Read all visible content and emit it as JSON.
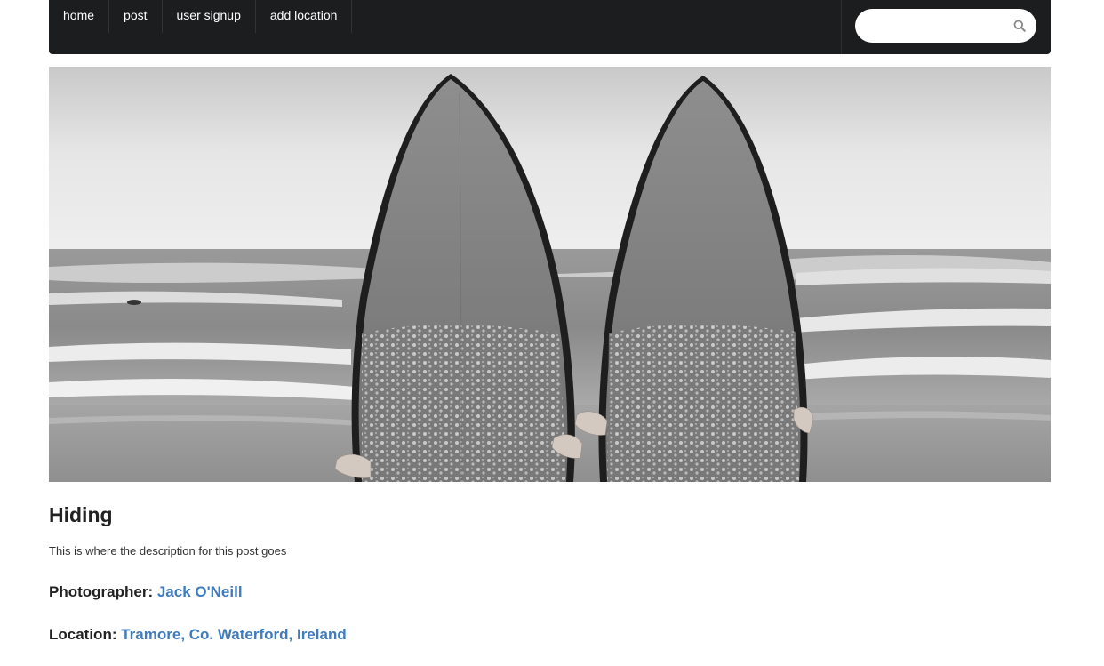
{
  "nav": {
    "items": [
      {
        "label": "home"
      },
      {
        "label": "post"
      },
      {
        "label": "user signup"
      },
      {
        "label": "add location"
      }
    ],
    "search": {
      "value": "",
      "placeholder": "",
      "icon": "search-icon"
    }
  },
  "hero": {
    "subject": "surfboards-on-beach"
  },
  "post": {
    "title": "Hiding",
    "description": "This is where the description for this post goes",
    "photographer_label": "Photographer:",
    "photographer_name": "Jack O'Neill",
    "location_label": "Location:",
    "location_name": "Tramore, Co. Waterford, Ireland"
  },
  "colors": {
    "navbar": "#1c1d1f",
    "link": "#3f7bbd"
  }
}
